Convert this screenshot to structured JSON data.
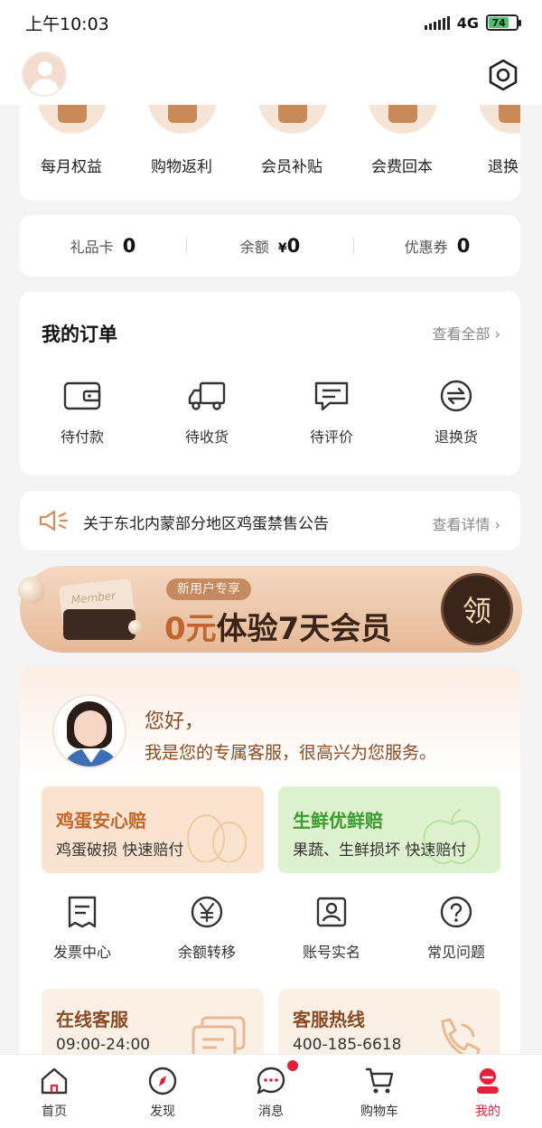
{
  "status_bar": {
    "time": "上午10:03",
    "network": "4G",
    "battery": "74"
  },
  "benefits": [
    {
      "label": "每月权益"
    },
    {
      "label": "购物返利"
    },
    {
      "label": "会员补贴"
    },
    {
      "label": "会费回本"
    },
    {
      "label": "退换"
    }
  ],
  "wallet": {
    "gift_card": {
      "label": "礼品卡",
      "value": "0"
    },
    "balance": {
      "label": "余额",
      "currency": "¥",
      "value": "0"
    },
    "coupon": {
      "label": "优惠券",
      "value": "0"
    }
  },
  "orders": {
    "title": "我的订单",
    "view_all": "查看全部 ›",
    "items": [
      {
        "label": "待付款",
        "icon": "wallet-icon"
      },
      {
        "label": "待收货",
        "icon": "truck-icon"
      },
      {
        "label": "待评价",
        "icon": "comment-icon"
      },
      {
        "label": "退换货",
        "icon": "exchange-icon"
      }
    ]
  },
  "notice": {
    "text": "关于东北内蒙部分地区鸡蛋禁售公告",
    "more": "查看详情 ›"
  },
  "member_banner": {
    "card_text": "Member",
    "tag": "新用户专享",
    "highlight": "0元",
    "headline": "体验7天会员",
    "claim_button": "领"
  },
  "service": {
    "greeting": "您好，",
    "intro": "我是您的专属客服，很高兴为您服务。",
    "guarantees": [
      {
        "title": "鸡蛋安心赔",
        "subtitle": "鸡蛋破损  快速赔付"
      },
      {
        "title": "生鲜优鲜赔",
        "subtitle": "果蔬、生鲜损坏  快速赔付"
      }
    ],
    "tools": [
      {
        "label": "发票中心",
        "icon": "invoice-icon"
      },
      {
        "label": "余额转移",
        "icon": "yen-icon"
      },
      {
        "label": "账号实名",
        "icon": "id-card-icon"
      },
      {
        "label": "常见问题",
        "icon": "question-icon"
      }
    ],
    "contacts": [
      {
        "title": "在线客服",
        "subtitle": "09:00-24:00"
      },
      {
        "title": "客服热线",
        "subtitle": "400-185-6618"
      }
    ]
  },
  "bottom_nav": [
    {
      "label": "首页",
      "icon": "home-icon"
    },
    {
      "label": "发现",
      "icon": "compass-icon"
    },
    {
      "label": "消息",
      "icon": "message-icon"
    },
    {
      "label": "购物车",
      "icon": "cart-icon"
    },
    {
      "label": "我的",
      "icon": "profile-icon",
      "active": true
    }
  ],
  "colors": {
    "accent": "#e5203a",
    "brand_brown": "#8a4a22",
    "banner_dark": "#3b2419"
  }
}
